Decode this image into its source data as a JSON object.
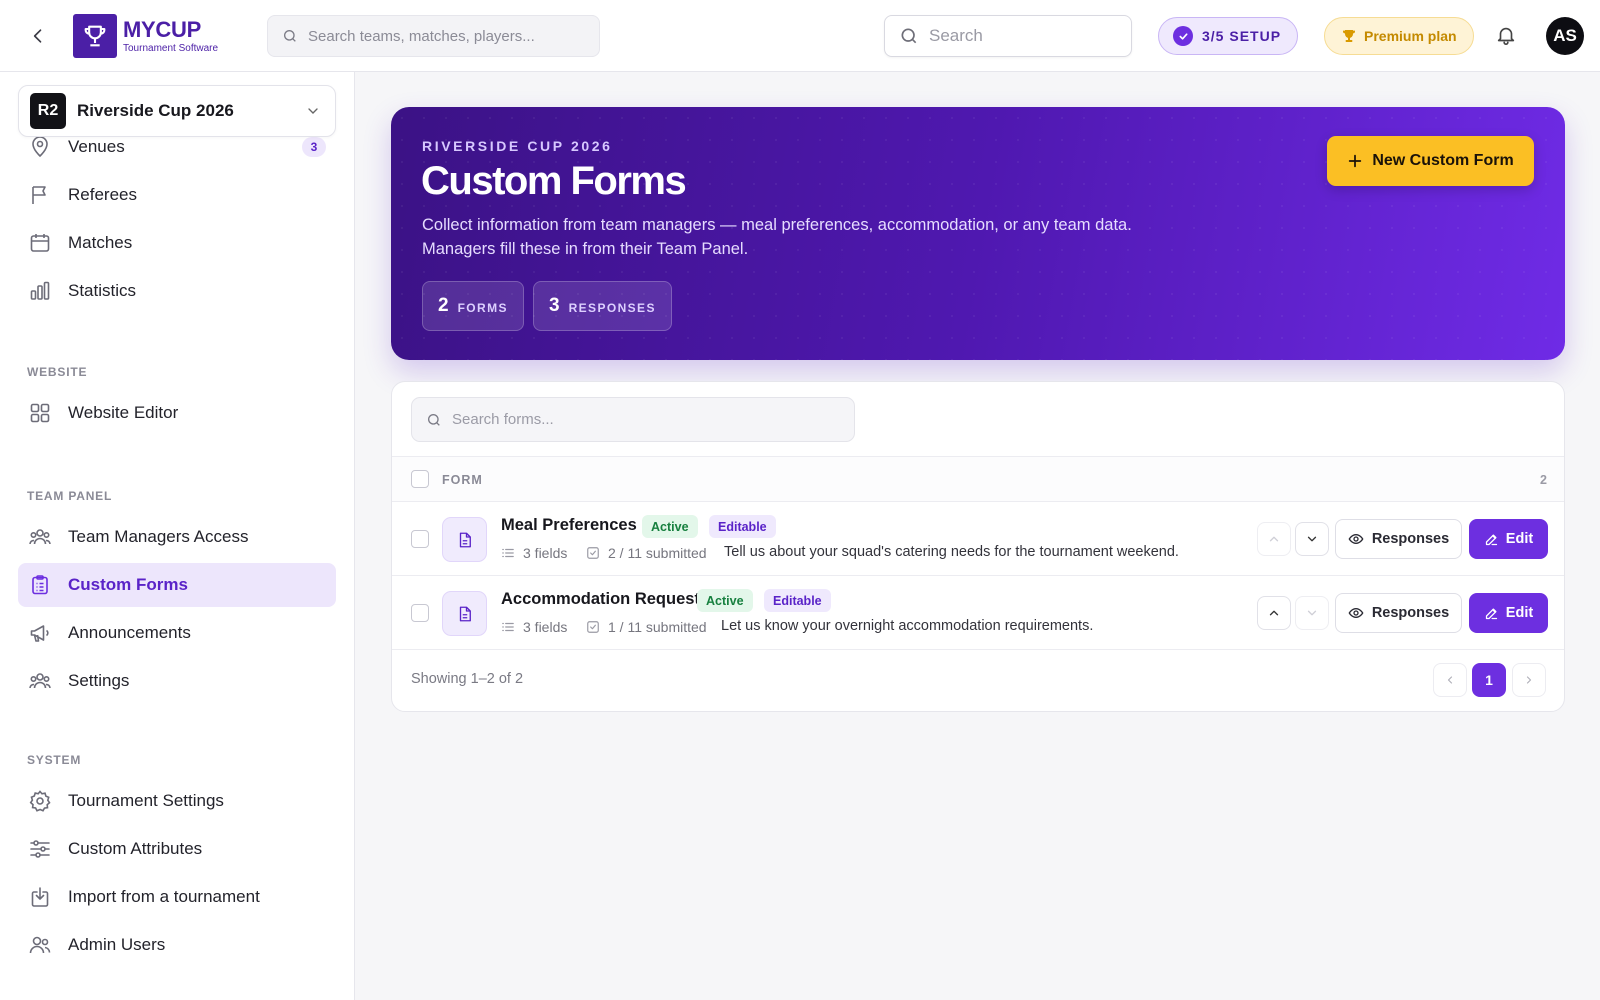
{
  "brand": {
    "name": "MYCUP",
    "tagline": "Tournament Software"
  },
  "topbar": {
    "search_placeholder": "Search teams, matches, players...",
    "search2_placeholder": "Search",
    "setup_label": "3/5 SETUP",
    "premium_label": "Premium plan",
    "avatar_initials": "AS"
  },
  "sidebar": {
    "tournament": {
      "badge": "R2",
      "name": "Riverside Cup 2026"
    },
    "items_top": [
      {
        "label": "Venues",
        "icon": "location-pin-icon",
        "count": "3"
      },
      {
        "label": "Referees",
        "icon": "flag-icon"
      },
      {
        "label": "Matches",
        "icon": "calendar-icon"
      },
      {
        "label": "Statistics",
        "icon": "bar-chart-icon"
      }
    ],
    "website_title": "WEBSITE",
    "website_items": [
      {
        "label": "Website Editor",
        "icon": "grid-icon"
      }
    ],
    "team_panel_title": "TEAM PANEL",
    "team_panel_items": [
      {
        "label": "Team Managers Access",
        "icon": "users-icon"
      },
      {
        "label": "Custom Forms",
        "icon": "clipboard-icon",
        "active": true
      },
      {
        "label": "Announcements",
        "icon": "megaphone-icon"
      },
      {
        "label": "Settings",
        "icon": "users-settings-icon"
      }
    ],
    "system_title": "SYSTEM",
    "system_items": [
      {
        "label": "Tournament Settings",
        "icon": "gear-icon"
      },
      {
        "label": "Custom Attributes",
        "icon": "sliders-icon"
      },
      {
        "label": "Import from a tournament",
        "icon": "import-icon"
      },
      {
        "label": "Admin Users",
        "icon": "admin-users-icon"
      }
    ]
  },
  "hero": {
    "kicker": "RIVERSIDE CUP 2026",
    "title": "Custom Forms",
    "description_line1": "Collect information from team managers — meal preferences, accommodation, or any team data.",
    "description_line2": "Managers fill these in from their Team Panel.",
    "stats": [
      {
        "value": "2",
        "unit": "FORMS"
      },
      {
        "value": "3",
        "unit": "RESPONSES"
      }
    ],
    "new_form_label": "New Custom Form"
  },
  "forms": {
    "search_placeholder": "Search forms...",
    "column_header": "FORM",
    "total_count": "2",
    "rows": [
      {
        "name": "Meal Preferences",
        "status": "Active",
        "mode": "Editable",
        "fields": "3 fields",
        "submitted": "2 / 11 submitted",
        "description": "Tell us about your squad's catering needs for the tournament weekend.",
        "up_disabled": true,
        "down_disabled": false
      },
      {
        "name": "Accommodation Request",
        "status": "Active",
        "mode": "Editable",
        "fields": "3 fields",
        "submitted": "1 / 11 submitted",
        "description": "Let us know your overnight accommodation requirements.",
        "up_disabled": false,
        "down_disabled": true
      }
    ],
    "responses_label": "Responses",
    "edit_label": "Edit",
    "showing": "Showing 1–2 of 2",
    "current_page": "1"
  },
  "colors": {
    "accent": "#6d2fe0",
    "brand": "#4b1fa6",
    "cta": "#fbbf24",
    "success": "#17803f"
  }
}
